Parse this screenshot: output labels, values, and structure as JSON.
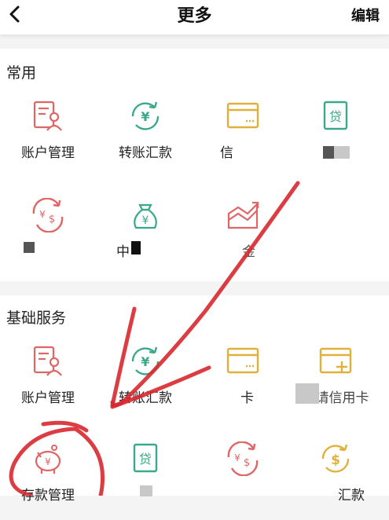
{
  "header": {
    "title": "更多",
    "edit_label": "编辑"
  },
  "sections": [
    {
      "title": "常用",
      "items": [
        {
          "label": "账户管理",
          "icon": "account-management-icon"
        },
        {
          "label": "转账汇款",
          "icon": "transfer-icon"
        },
        {
          "label": "信",
          "icon": "card-icon"
        },
        {
          "label": "",
          "icon": "loan-icon"
        },
        {
          "label": "",
          "icon": "currency-exchange-icon"
        },
        {
          "label": "中",
          "icon": "money-bag-icon"
        },
        {
          "label": "金",
          "icon": "chart-icon"
        }
      ]
    },
    {
      "title": "基础服务",
      "items": [
        {
          "label": "账户管理",
          "icon": "account-management-icon"
        },
        {
          "label": "转账汇款",
          "icon": "transfer-icon"
        },
        {
          "label": "卡",
          "icon": "card-icon"
        },
        {
          "label": "申请信用卡",
          "icon": "apply-credit-card-icon"
        },
        {
          "label": "存款管理",
          "icon": "piggy-bank-icon"
        },
        {
          "label": "",
          "icon": "loan-icon"
        },
        {
          "label": "",
          "icon": "currency-exchange-icon"
        },
        {
          "label": "汇款",
          "icon": "dollar-cycle-icon"
        }
      ]
    }
  ],
  "colors": {
    "red": "#e06565",
    "teal": "#3aa98a",
    "gold": "#e0b13a",
    "annotation": "#d8282e"
  }
}
